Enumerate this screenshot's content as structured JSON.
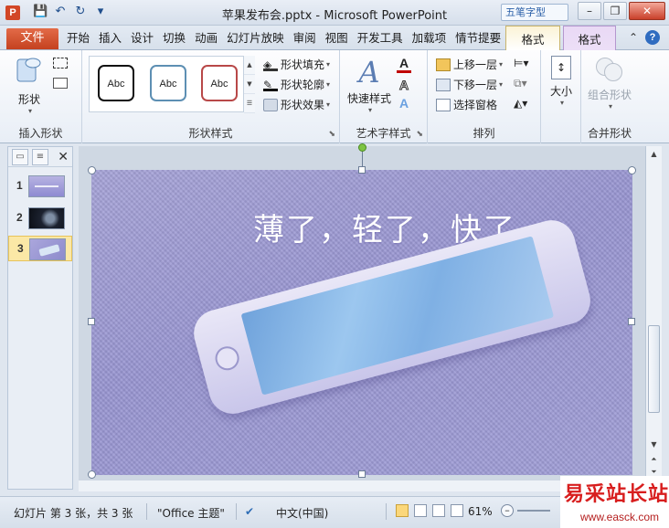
{
  "window": {
    "app_icon": "P",
    "title": "苹果发布会.pptx  -  Microsoft PowerPoint",
    "brand_badge": "五笔字型",
    "qat": {
      "save": "💾",
      "undo": "↶",
      "redo": "↻",
      "customize": "▾"
    },
    "controls": {
      "minimize": "–",
      "restore": "❐",
      "close": "✕"
    }
  },
  "tabs": {
    "file": "文件",
    "items": [
      "开始",
      "插入",
      "设计",
      "切换",
      "动画",
      "幻灯片放映",
      "审阅",
      "视图",
      "开发工具",
      "加载项",
      "情节提要"
    ],
    "context_drawing": "格式",
    "context_picture": "格式",
    "collapse": "⌃",
    "help": "?"
  },
  "ribbon": {
    "insert_shapes": {
      "label": "插入形状",
      "shape_btn": "形状"
    },
    "shape_styles": {
      "label": "形状样式",
      "gallery_item": "Abc",
      "fill": "形状填充",
      "outline": "形状轮廓",
      "effects": "形状效果"
    },
    "wordart": {
      "label": "艺术字样式",
      "quick_styles": "快速样式",
      "glyph": "A"
    },
    "arrange": {
      "label": "排列",
      "bring_forward": "上移一层",
      "send_backward": "下移一层",
      "selection_pane": "选择窗格"
    },
    "size": {
      "label": "",
      "size_btn": "大小"
    },
    "merge": {
      "label": "合并形状",
      "group_btn": "组合形状"
    }
  },
  "thumbnails": [
    {
      "num": "1"
    },
    {
      "num": "2"
    },
    {
      "num": "3"
    }
  ],
  "slide": {
    "title": "薄了，轻了，快了"
  },
  "status": {
    "slide_info": "幻灯片 第 3 张，共 3 张",
    "theme": "\"Office 主题\"",
    "language": "中文(中国)",
    "zoom": "61%",
    "zoom_minus": "–",
    "zoom_plus": "+"
  },
  "watermark": {
    "main": "易采站长站",
    "sub": "www.easck.com"
  }
}
